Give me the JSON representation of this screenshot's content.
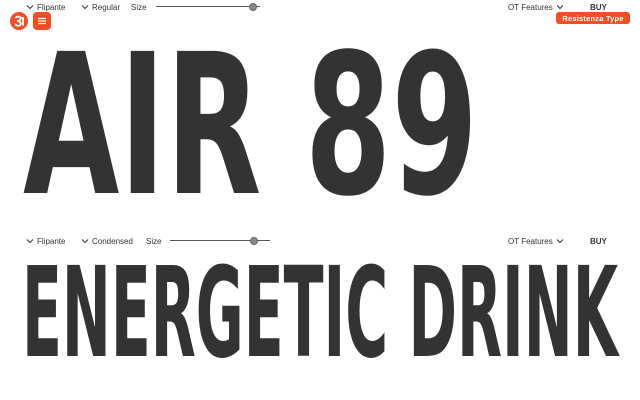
{
  "rows": [
    {
      "family": "Flipante",
      "style": "Regular",
      "size_label": "Size",
      "size_value": 0.97,
      "ot_label": "OT Features",
      "buy_label": "BUY",
      "sample_text": "AIR 89"
    },
    {
      "family": "Flipante",
      "style": "Condensed",
      "size_label": "Size",
      "size_value": 0.87,
      "ot_label": "OT Features",
      "buy_label": "BUY",
      "sample_text": "ENERGETIC DRINK"
    }
  ],
  "brand": {
    "name": "Resistenza Type",
    "accent": "#f04e23"
  },
  "icons": {
    "logo": "resistenza-logo-icon",
    "menu": "hamburger-menu-icon",
    "dropdown": "chevron-down-icon"
  }
}
